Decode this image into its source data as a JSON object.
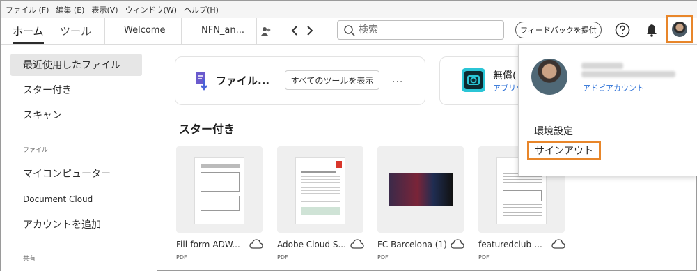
{
  "menu": [
    "ファイル (F)",
    "編集 (E)",
    "表示(V)",
    "ウィンドウ(W)",
    "ヘルプ(H)"
  ],
  "tabs": {
    "home": "ホーム",
    "tools": "ツール",
    "docs": [
      "Welcome",
      "NFN_an..."
    ]
  },
  "search": {
    "placeholder": "検索"
  },
  "header": {
    "feedback_label": "フィードバックを提供"
  },
  "sidebar": {
    "recent": "最近使用したファイル",
    "starred": "スター付き",
    "scan": "スキャン",
    "files_heading": "ファイル",
    "my_computer": "マイコンピューター",
    "document_cloud": "Document Cloud",
    "add_account": "アカウントを追加",
    "shared_heading": "共有"
  },
  "main": {
    "card1_title": "ファイル...",
    "all_tools_label": "すべてのツールを表示",
    "more": "...",
    "card2_title": "無償(",
    "card2_link": "アプリケ",
    "starred_heading": "スター付き",
    "files": [
      {
        "name": "Fill-form-ADW...",
        "type": "PDF"
      },
      {
        "name": "Adobe Cloud S...",
        "type": "PDF"
      },
      {
        "name": "FC Barcelona (1)",
        "type": "PDF"
      },
      {
        "name": "featuredclub-...",
        "type": "PDF"
      }
    ]
  },
  "account_menu": {
    "account_link": "アドビアカウント",
    "preferences": "環境設定",
    "sign_out": "サインアウト"
  },
  "colors": {
    "highlight": "#e8862a",
    "link": "#2a6fd6"
  }
}
